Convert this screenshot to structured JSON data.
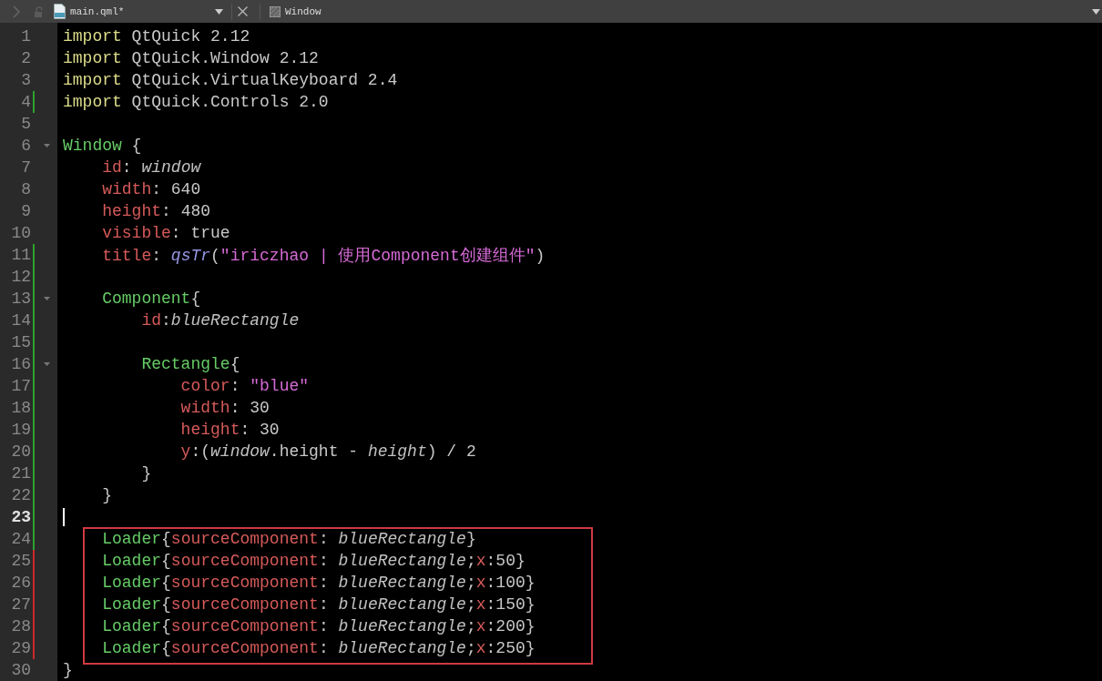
{
  "toolbar": {
    "file_name": "main.qml*",
    "symbol": "Window"
  },
  "lines": [
    {
      "number": "1",
      "added": false,
      "modified": false,
      "fold": false,
      "current": false,
      "boxed": false,
      "tokens": [
        {
          "text": "import",
          "kind": "keyword"
        },
        {
          "text": " QtQuick 2.12",
          "kind": "plain"
        }
      ]
    },
    {
      "number": "2",
      "added": false,
      "modified": false,
      "fold": false,
      "current": false,
      "boxed": false,
      "tokens": [
        {
          "text": "import",
          "kind": "keyword"
        },
        {
          "text": " QtQuick.Window 2.12",
          "kind": "plain"
        }
      ]
    },
    {
      "number": "3",
      "added": false,
      "modified": false,
      "fold": false,
      "current": false,
      "boxed": false,
      "tokens": [
        {
          "text": "import",
          "kind": "keyword"
        },
        {
          "text": " QtQuick.VirtualKeyboard 2.4",
          "kind": "plain"
        }
      ]
    },
    {
      "number": "4",
      "added": true,
      "modified": false,
      "fold": false,
      "current": false,
      "boxed": false,
      "tokens": [
        {
          "text": "import",
          "kind": "keyword"
        },
        {
          "text": " QtQuick.Controls 2.0",
          "kind": "plain"
        }
      ]
    },
    {
      "number": "5",
      "added": false,
      "modified": false,
      "fold": false,
      "current": false,
      "boxed": false
    },
    {
      "number": "6",
      "added": false,
      "modified": false,
      "fold": true,
      "current": false,
      "boxed": false,
      "tokens": [
        {
          "text": "Window",
          "kind": "type"
        },
        {
          "text": " {",
          "kind": "plain"
        }
      ]
    },
    {
      "number": "7",
      "added": false,
      "modified": false,
      "fold": false,
      "current": false,
      "boxed": false,
      "tokens": [
        {
          "text": "    id",
          "kind": "property"
        },
        {
          "text": ": ",
          "kind": "plain"
        },
        {
          "text": "window",
          "kind": "italic"
        }
      ]
    },
    {
      "number": "8",
      "added": false,
      "modified": false,
      "fold": false,
      "current": false,
      "boxed": false,
      "tokens": [
        {
          "text": "    width",
          "kind": "property"
        },
        {
          "text": ": 640",
          "kind": "plain"
        }
      ]
    },
    {
      "number": "9",
      "added": false,
      "modified": false,
      "fold": false,
      "current": false,
      "boxed": false,
      "tokens": [
        {
          "text": "    height",
          "kind": "property"
        },
        {
          "text": ": 480",
          "kind": "plain"
        }
      ]
    },
    {
      "number": "10",
      "added": false,
      "modified": false,
      "fold": false,
      "current": false,
      "boxed": false,
      "tokens": [
        {
          "text": "    visible",
          "kind": "property"
        },
        {
          "text": ": true",
          "kind": "plain"
        }
      ]
    },
    {
      "number": "11",
      "added": true,
      "modified": false,
      "fold": false,
      "current": false,
      "boxed": false,
      "tokens": [
        {
          "text": "    title",
          "kind": "property"
        },
        {
          "text": ": ",
          "kind": "plain"
        },
        {
          "text": "qsTr",
          "kind": "function"
        },
        {
          "text": "(",
          "kind": "plain"
        },
        {
          "text": "\"iriczhao | 使用Component创建组件\"",
          "kind": "string"
        },
        {
          "text": ")",
          "kind": "plain"
        }
      ]
    },
    {
      "number": "12",
      "added": true,
      "modified": false,
      "fold": false,
      "current": false,
      "boxed": false
    },
    {
      "number": "13",
      "added": true,
      "modified": false,
      "fold": true,
      "current": false,
      "boxed": false,
      "tokens": [
        {
          "text": "    Component",
          "kind": "type"
        },
        {
          "text": "{",
          "kind": "plain"
        }
      ]
    },
    {
      "number": "14",
      "added": true,
      "modified": false,
      "fold": false,
      "current": false,
      "boxed": false,
      "tokens": [
        {
          "text": "        id",
          "kind": "property"
        },
        {
          "text": ":",
          "kind": "plain"
        },
        {
          "text": "blueRectangle",
          "kind": "italic"
        }
      ]
    },
    {
      "number": "15",
      "added": true,
      "modified": false,
      "fold": false,
      "current": false,
      "boxed": false
    },
    {
      "number": "16",
      "added": true,
      "modified": false,
      "fold": true,
      "current": false,
      "boxed": false,
      "tokens": [
        {
          "text": "        Rectangle",
          "kind": "type"
        },
        {
          "text": "{",
          "kind": "plain"
        }
      ]
    },
    {
      "number": "17",
      "added": true,
      "modified": false,
      "fold": false,
      "current": false,
      "boxed": false,
      "tokens": [
        {
          "text": "            color",
          "kind": "property"
        },
        {
          "text": ": ",
          "kind": "plain"
        },
        {
          "text": "\"blue\"",
          "kind": "string"
        }
      ]
    },
    {
      "number": "18",
      "added": true,
      "modified": false,
      "fold": false,
      "current": false,
      "boxed": false,
      "tokens": [
        {
          "text": "            width",
          "kind": "property"
        },
        {
          "text": ": 30",
          "kind": "plain"
        }
      ]
    },
    {
      "number": "19",
      "added": true,
      "modified": false,
      "fold": false,
      "current": false,
      "boxed": false,
      "tokens": [
        {
          "text": "            height",
          "kind": "property"
        },
        {
          "text": ": 30",
          "kind": "plain"
        }
      ]
    },
    {
      "number": "20",
      "added": true,
      "modified": false,
      "fold": false,
      "current": false,
      "boxed": false,
      "tokens": [
        {
          "text": "            y",
          "kind": "property"
        },
        {
          "text": ":(",
          "kind": "plain"
        },
        {
          "text": "window",
          "kind": "italic"
        },
        {
          "text": ".height - ",
          "kind": "plain"
        },
        {
          "text": "height",
          "kind": "italic"
        },
        {
          "text": ") / 2",
          "kind": "plain"
        }
      ]
    },
    {
      "number": "21",
      "added": true,
      "modified": false,
      "fold": false,
      "current": false,
      "boxed": false,
      "tokens": [
        {
          "text": "        }",
          "kind": "plain"
        }
      ]
    },
    {
      "number": "22",
      "added": true,
      "modified": false,
      "fold": false,
      "current": false,
      "boxed": false,
      "tokens": [
        {
          "text": "    }",
          "kind": "plain"
        }
      ]
    },
    {
      "number": "23",
      "added": true,
      "modified": false,
      "fold": false,
      "current": true,
      "boxed": false
    },
    {
      "number": "24",
      "added": true,
      "modified": false,
      "fold": false,
      "current": false,
      "boxed": true,
      "tokens": [
        {
          "text": "    Loader",
          "kind": "type"
        },
        {
          "text": "{",
          "kind": "plain"
        },
        {
          "text": "sourceComponent",
          "kind": "property"
        },
        {
          "text": ": ",
          "kind": "plain"
        },
        {
          "text": "blueRectangle",
          "kind": "italic"
        },
        {
          "text": "}",
          "kind": "plain"
        }
      ]
    },
    {
      "number": "25",
      "added": false,
      "modified": true,
      "fold": false,
      "current": false,
      "boxed": true,
      "tokens": [
        {
          "text": "    Loader",
          "kind": "type"
        },
        {
          "text": "{",
          "kind": "plain"
        },
        {
          "text": "sourceComponent",
          "kind": "property"
        },
        {
          "text": ": ",
          "kind": "plain"
        },
        {
          "text": "blueRectangle",
          "kind": "italic"
        },
        {
          "text": ";",
          "kind": "plain"
        },
        {
          "text": "x",
          "kind": "property"
        },
        {
          "text": ":50}",
          "kind": "plain"
        }
      ]
    },
    {
      "number": "26",
      "added": false,
      "modified": true,
      "fold": false,
      "current": false,
      "boxed": true,
      "tokens": [
        {
          "text": "    Loader",
          "kind": "type"
        },
        {
          "text": "{",
          "kind": "plain"
        },
        {
          "text": "sourceComponent",
          "kind": "property"
        },
        {
          "text": ": ",
          "kind": "plain"
        },
        {
          "text": "blueRectangle",
          "kind": "italic"
        },
        {
          "text": ";",
          "kind": "plain"
        },
        {
          "text": "x",
          "kind": "property"
        },
        {
          "text": ":100}",
          "kind": "plain"
        }
      ]
    },
    {
      "number": "27",
      "added": false,
      "modified": true,
      "fold": false,
      "current": false,
      "boxed": true,
      "tokens": [
        {
          "text": "    Loader",
          "kind": "type"
        },
        {
          "text": "{",
          "kind": "plain"
        },
        {
          "text": "sourceComponent",
          "kind": "property"
        },
        {
          "text": ": ",
          "kind": "plain"
        },
        {
          "text": "blueRectangle",
          "kind": "italic"
        },
        {
          "text": ";",
          "kind": "plain"
        },
        {
          "text": "x",
          "kind": "property"
        },
        {
          "text": ":150}",
          "kind": "plain"
        }
      ]
    },
    {
      "number": "28",
      "added": false,
      "modified": true,
      "fold": false,
      "current": false,
      "boxed": true,
      "tokens": [
        {
          "text": "    Loader",
          "kind": "type"
        },
        {
          "text": "{",
          "kind": "plain"
        },
        {
          "text": "sourceComponent",
          "kind": "property"
        },
        {
          "text": ": ",
          "kind": "plain"
        },
        {
          "text": "blueRectangle",
          "kind": "italic"
        },
        {
          "text": ";",
          "kind": "plain"
        },
        {
          "text": "x",
          "kind": "property"
        },
        {
          "text": ":200}",
          "kind": "plain"
        }
      ]
    },
    {
      "number": "29",
      "added": false,
      "modified": true,
      "fold": false,
      "current": false,
      "boxed": true,
      "tokens": [
        {
          "text": "    Loader",
          "kind": "type"
        },
        {
          "text": "{",
          "kind": "plain"
        },
        {
          "text": "sourceComponent",
          "kind": "property"
        },
        {
          "text": ": ",
          "kind": "plain"
        },
        {
          "text": "blueRectangle",
          "kind": "italic"
        },
        {
          "text": ";",
          "kind": "plain"
        },
        {
          "text": "x",
          "kind": "property"
        },
        {
          "text": ":250}",
          "kind": "plain"
        }
      ]
    },
    {
      "number": "30",
      "added": false,
      "modified": false,
      "fold": false,
      "current": false,
      "boxed": false,
      "tokens": [
        {
          "text": "}",
          "kind": "plain"
        }
      ]
    }
  ]
}
